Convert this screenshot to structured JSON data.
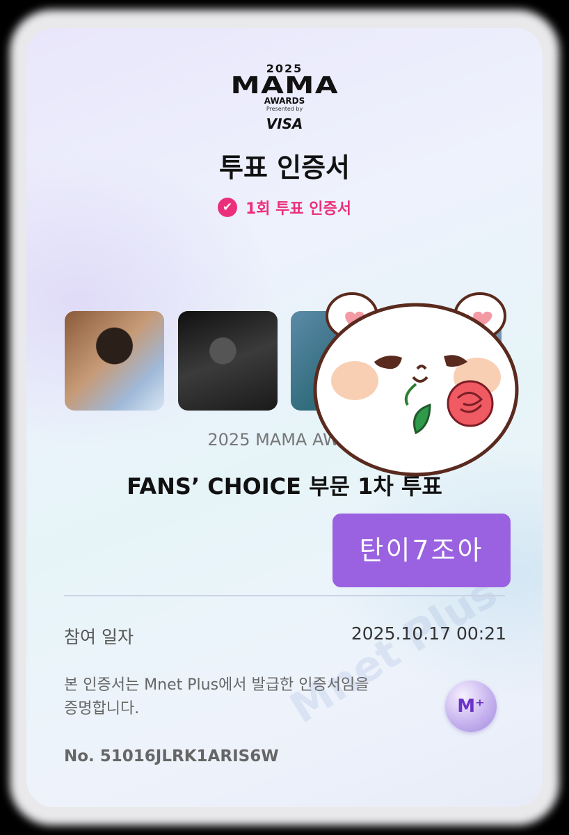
{
  "logo": {
    "year": "2025",
    "brand": "MAMA",
    "awards": "AWARDS",
    "presented": "Presented by",
    "sponsor": "VISA"
  },
  "certificate": {
    "title": "투표 인증서",
    "badge_label": "1회 투표 인증서",
    "badge_icon": "verified-check-icon",
    "accent_color": "#ec2f7b"
  },
  "event": {
    "subtitle": "2025 MAMA AWAR",
    "headline": "FANS’ CHOICE 부문 1차 투표"
  },
  "sticker": {
    "text": "탄이7조아",
    "color": "#9a62e0"
  },
  "details": {
    "date_label": "참여 일자",
    "date_value": "2025.10.17 00:21",
    "issuer_note": "본 인증서는 Mnet Plus에서 발급한 인증서임을 증명합니다.",
    "serial": "No. 51016JLRK1ARIS6W",
    "app_icon": "mnet-plus-icon",
    "watermark": "Mnet Plus"
  }
}
